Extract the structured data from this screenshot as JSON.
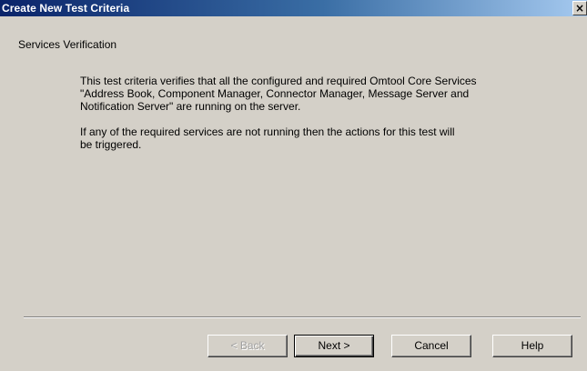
{
  "window": {
    "title": "Create New Test Criteria",
    "close_glyph": "×"
  },
  "page": {
    "header": "Services Verification",
    "paragraphs": [
      "This test criteria verifies that all the configured and required Omtool Core Services\n\"Address Book, Component Manager, Connector Manager, Message Server and\nNotification Server\" are running on the server.",
      "If any of the required services are not running then the actions for this test will\nbe triggered."
    ]
  },
  "buttons": {
    "back": "< Back",
    "next": "Next >",
    "cancel": "Cancel",
    "help": "Help"
  },
  "colors": {
    "title_bar_start": "#0a246a",
    "title_bar_end": "#a6caf0",
    "dialog_face": "#d4d0c8"
  }
}
